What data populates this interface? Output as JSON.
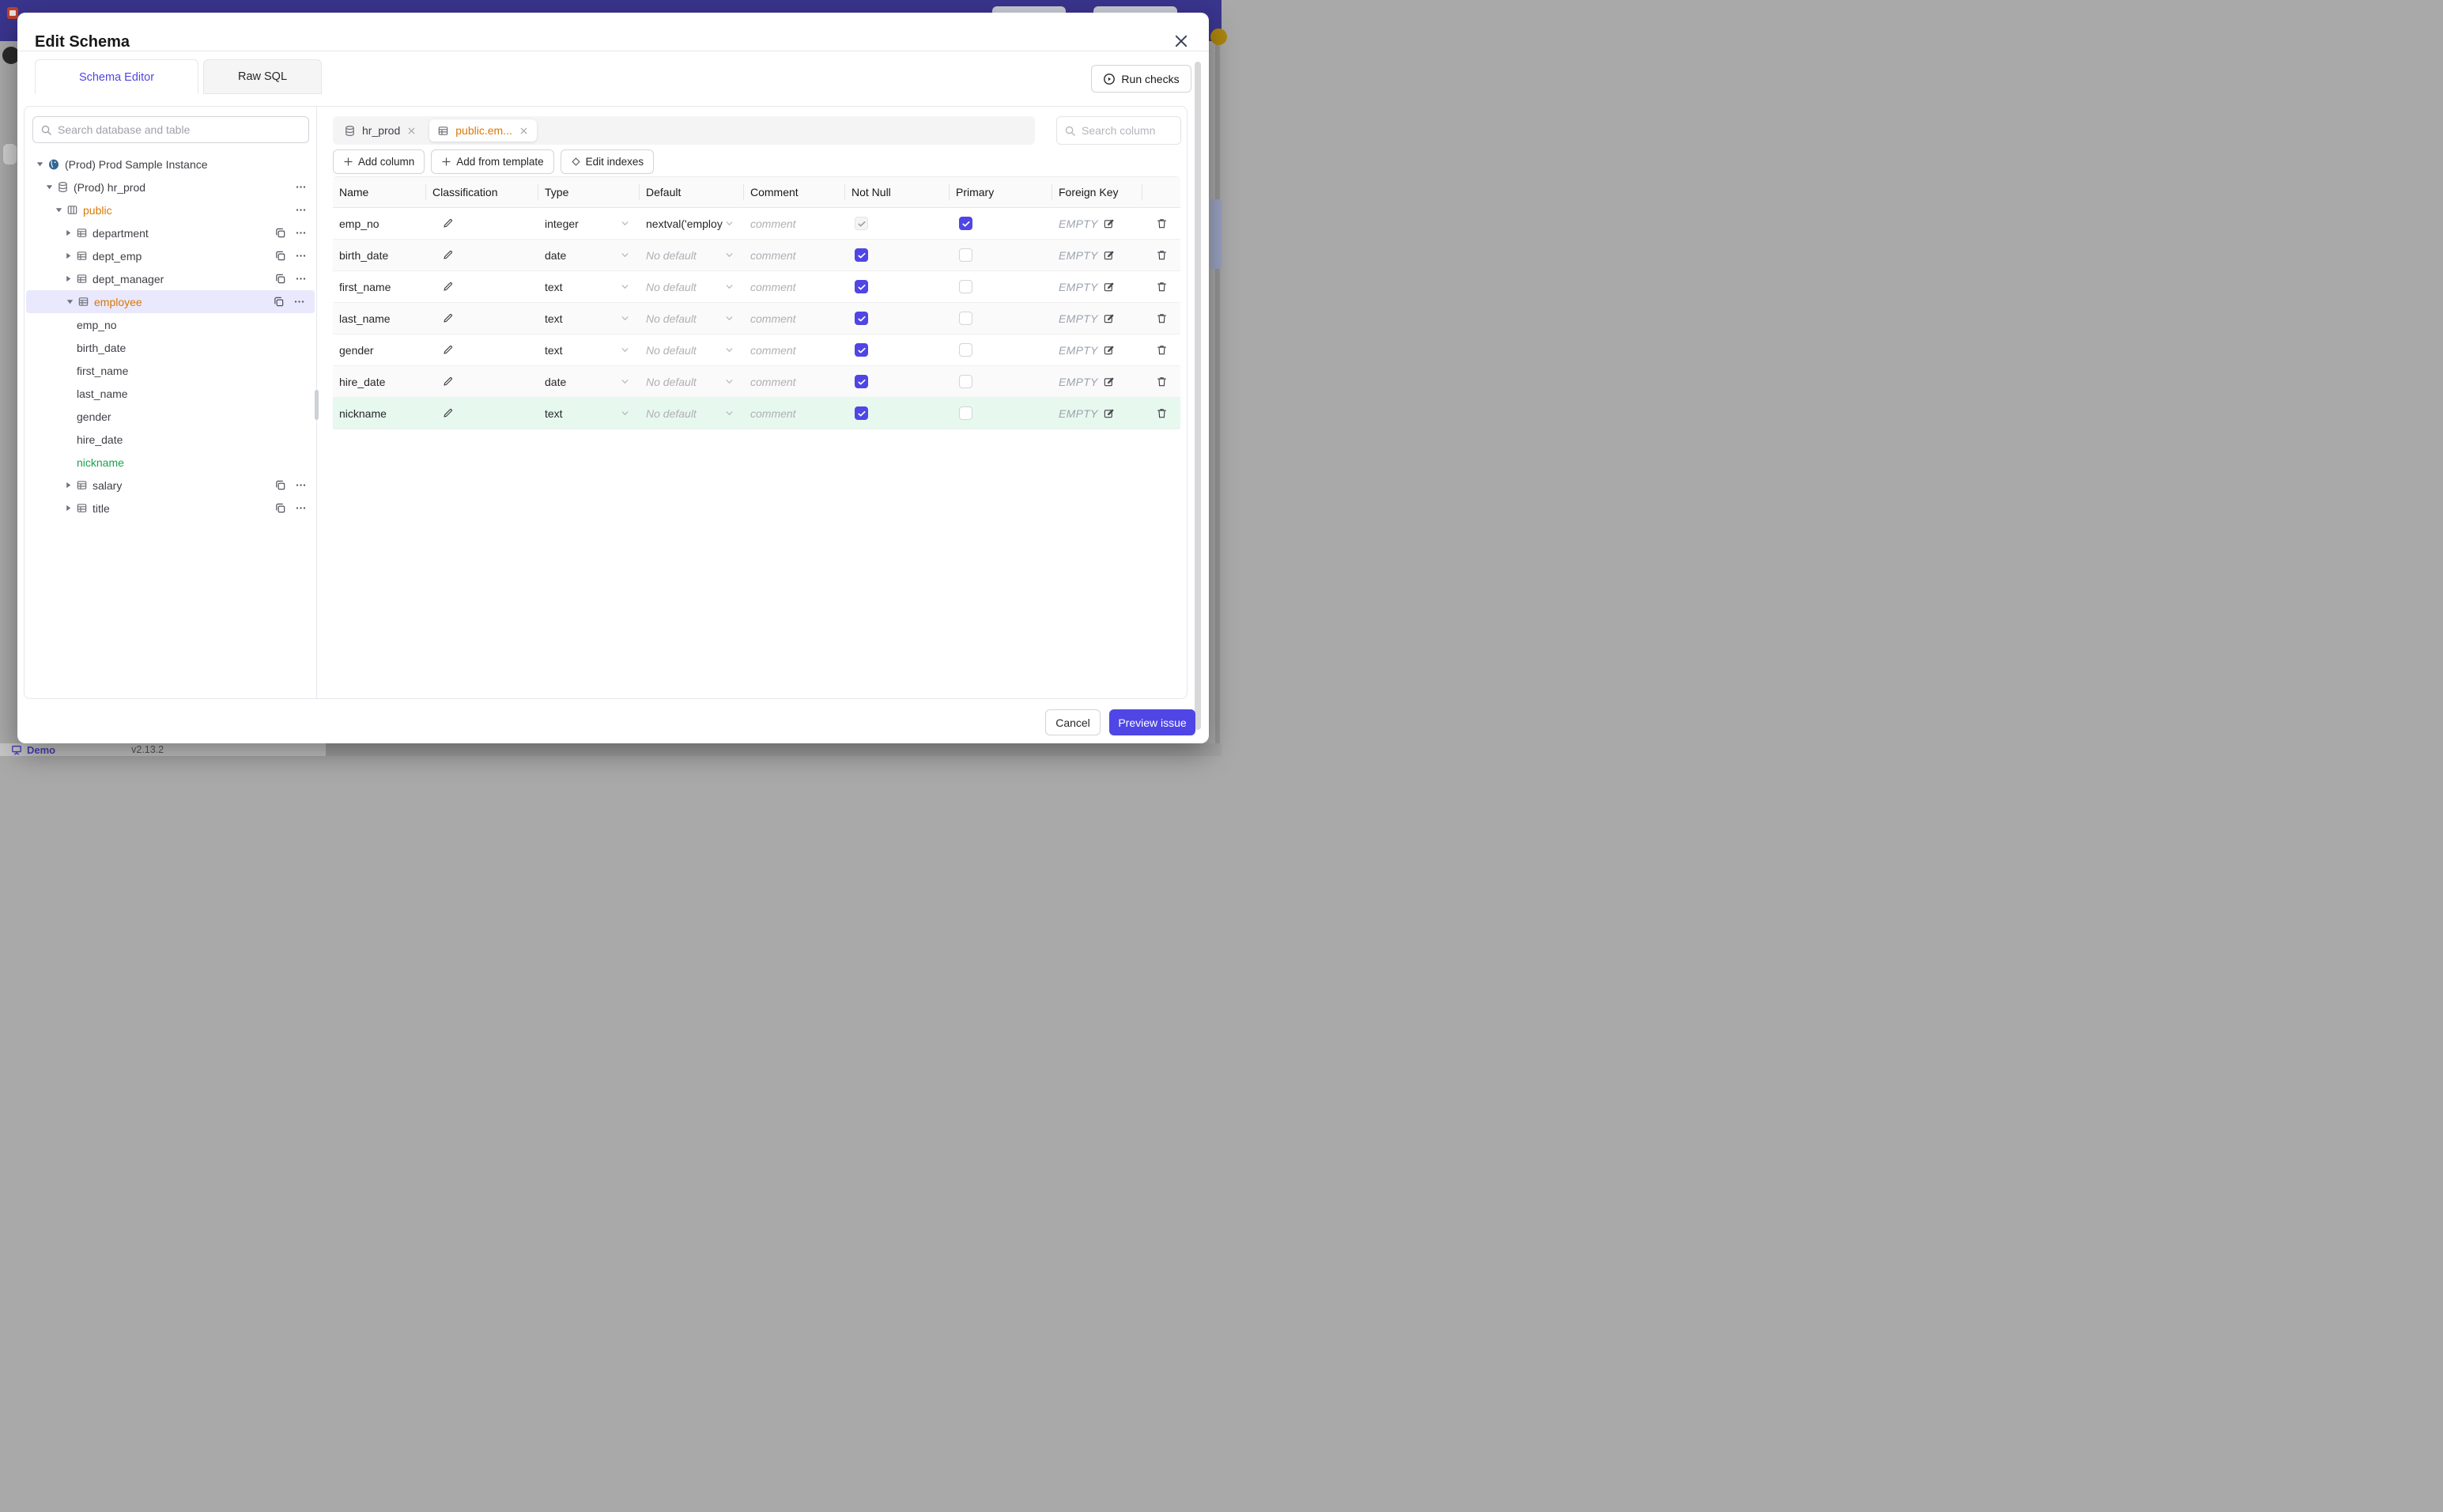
{
  "colors": {
    "accent": "#4f46e5",
    "modified_orange": "#d97706",
    "created_green": "#16a34a",
    "selected_tree_row_bg": "#e9e8fc",
    "created_row_bg": "#e7f8ee",
    "app_header_bg": "#3a358e"
  },
  "backdrop": {
    "demo_label": "Demo",
    "version": "v2.13.2"
  },
  "modal": {
    "title": "Edit Schema",
    "run_checks_label": "Run checks",
    "tabs": [
      {
        "label": "Schema Editor",
        "active": true
      },
      {
        "label": "Raw SQL",
        "active": false
      }
    ],
    "footer": {
      "cancel_label": "Cancel",
      "primary_label": "Preview issue"
    }
  },
  "left_panel": {
    "search_placeholder": "Search database and table",
    "tree": [
      {
        "label": "(Prod) Prod Sample Instance",
        "level": 0,
        "caret": "down",
        "icon": "postgres-icon"
      },
      {
        "label": "(Prod) hr_prod",
        "level": 1,
        "caret": "down",
        "icon": "database-icon",
        "actions": [
          "more"
        ]
      },
      {
        "label": "public",
        "level": 2,
        "caret": "down",
        "icon": "schema-icon",
        "state": "modified",
        "actions": [
          "more"
        ]
      },
      {
        "label": "department",
        "level": 3,
        "caret": "right",
        "icon": "table-icon",
        "actions": [
          "copy",
          "more"
        ]
      },
      {
        "label": "dept_emp",
        "level": 3,
        "caret": "right",
        "icon": "table-icon",
        "actions": [
          "copy",
          "more"
        ]
      },
      {
        "label": "dept_manager",
        "level": 3,
        "caret": "right",
        "icon": "table-icon",
        "actions": [
          "copy",
          "more"
        ]
      },
      {
        "label": "employee",
        "level": 3,
        "caret": "down",
        "icon": "table-icon",
        "state": "modified",
        "selected": true,
        "actions": [
          "copy",
          "more"
        ]
      },
      {
        "label": "emp_no",
        "level": 4,
        "kind": "column"
      },
      {
        "label": "birth_date",
        "level": 4,
        "kind": "column"
      },
      {
        "label": "first_name",
        "level": 4,
        "kind": "column"
      },
      {
        "label": "last_name",
        "level": 4,
        "kind": "column"
      },
      {
        "label": "gender",
        "level": 4,
        "kind": "column"
      },
      {
        "label": "hire_date",
        "level": 4,
        "kind": "column"
      },
      {
        "label": "nickname",
        "level": 4,
        "kind": "column",
        "state": "created"
      },
      {
        "label": "salary",
        "level": 3,
        "caret": "right",
        "icon": "table-icon",
        "actions": [
          "copy",
          "more"
        ]
      },
      {
        "label": "title",
        "level": 3,
        "caret": "right",
        "icon": "table-icon",
        "actions": [
          "copy",
          "more"
        ]
      }
    ]
  },
  "editor": {
    "chips": [
      {
        "label": "hr_prod",
        "icon": "database-icon",
        "active": false
      },
      {
        "label": "public.em...",
        "icon": "table-icon",
        "active": true,
        "state": "modified"
      }
    ],
    "search_placeholder": "Search column",
    "toolbar": [
      {
        "icon": "plus-icon",
        "label": "Add column"
      },
      {
        "icon": "plus-icon",
        "label": "Add from template"
      },
      {
        "icon": "diamond-icon",
        "label": "Edit indexes"
      }
    ],
    "table": {
      "headers": [
        "Name",
        "Classification",
        "Type",
        "Default",
        "Comment",
        "Not Null",
        "Primary",
        "Foreign Key"
      ],
      "placeholders": {
        "comment": "comment",
        "no_default": "No default",
        "foreign_key": "EMPTY"
      },
      "rows": [
        {
          "name": "emp_no",
          "type": "integer",
          "default_value": "nextval('employ",
          "not_null": "checked-disabled",
          "primary": "checked",
          "bg": "plain"
        },
        {
          "name": "birth_date",
          "type": "date",
          "default_value": null,
          "not_null": "checked",
          "primary": "unchecked",
          "bg": "alt"
        },
        {
          "name": "first_name",
          "type": "text",
          "default_value": null,
          "not_null": "checked",
          "primary": "unchecked",
          "bg": "plain"
        },
        {
          "name": "last_name",
          "type": "text",
          "default_value": null,
          "not_null": "checked",
          "primary": "unchecked",
          "bg": "alt"
        },
        {
          "name": "gender",
          "type": "text",
          "default_value": null,
          "not_null": "checked",
          "primary": "unchecked",
          "bg": "plain"
        },
        {
          "name": "hire_date",
          "type": "date",
          "default_value": null,
          "not_null": "checked",
          "primary": "unchecked",
          "bg": "alt"
        },
        {
          "name": "nickname",
          "type": "text",
          "default_value": null,
          "not_null": "checked",
          "primary": "unchecked",
          "bg": "created"
        }
      ]
    }
  }
}
